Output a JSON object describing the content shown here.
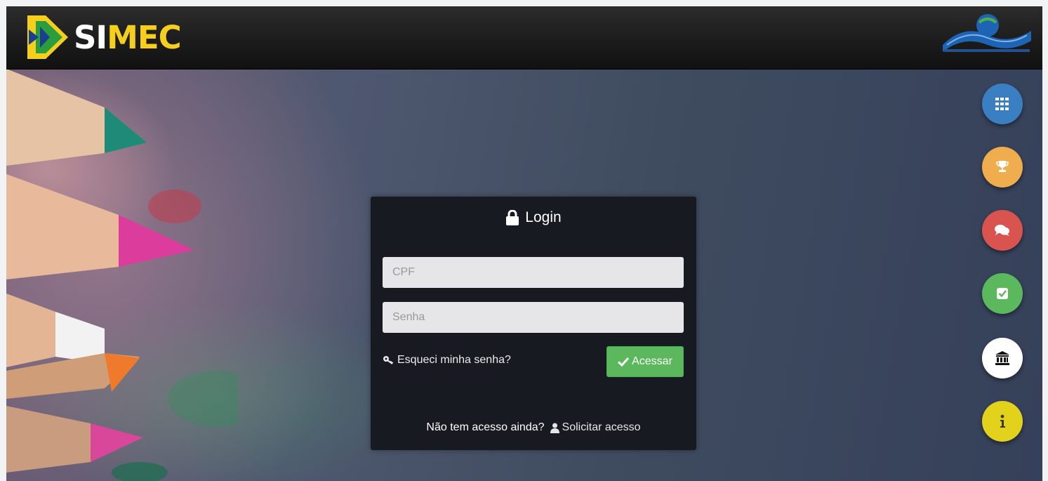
{
  "header": {
    "brand": {
      "text_white": "SI",
      "text_yellow": "MEC",
      "logo_icon": "simec-flag-logo"
    },
    "gov_logo_icon": "brasil-governo-federal-logo"
  },
  "login": {
    "title": "Login",
    "title_icon": "lock-icon",
    "cpf_placeholder": "CPF",
    "senha_placeholder": "Senha",
    "forgot_label": "Esqueci minha senha?",
    "forgot_icon": "key-icon",
    "submit_label": "Acessar",
    "submit_icon": "check-icon",
    "no_access_label": "Não tem acesso ainda?",
    "request_label": "Solicitar acesso",
    "request_icon": "user-icon"
  },
  "side_buttons": [
    {
      "icon": "grid-icon",
      "color": "#3a7fc1"
    },
    {
      "icon": "trophy-icon",
      "color": "#f0ad4e"
    },
    {
      "icon": "chat-icon",
      "color": "#d9534f"
    },
    {
      "icon": "checkbox-icon",
      "color": "#5cb85c"
    },
    {
      "icon": "institution-icon",
      "color": "#ffffff"
    },
    {
      "icon": "info-icon",
      "color": "#e3d21c"
    }
  ],
  "colors": {
    "topbar": "#1b1b1b",
    "accent_yellow": "#f6cf1c",
    "success": "#5cb85c",
    "panel": "#171a20"
  }
}
